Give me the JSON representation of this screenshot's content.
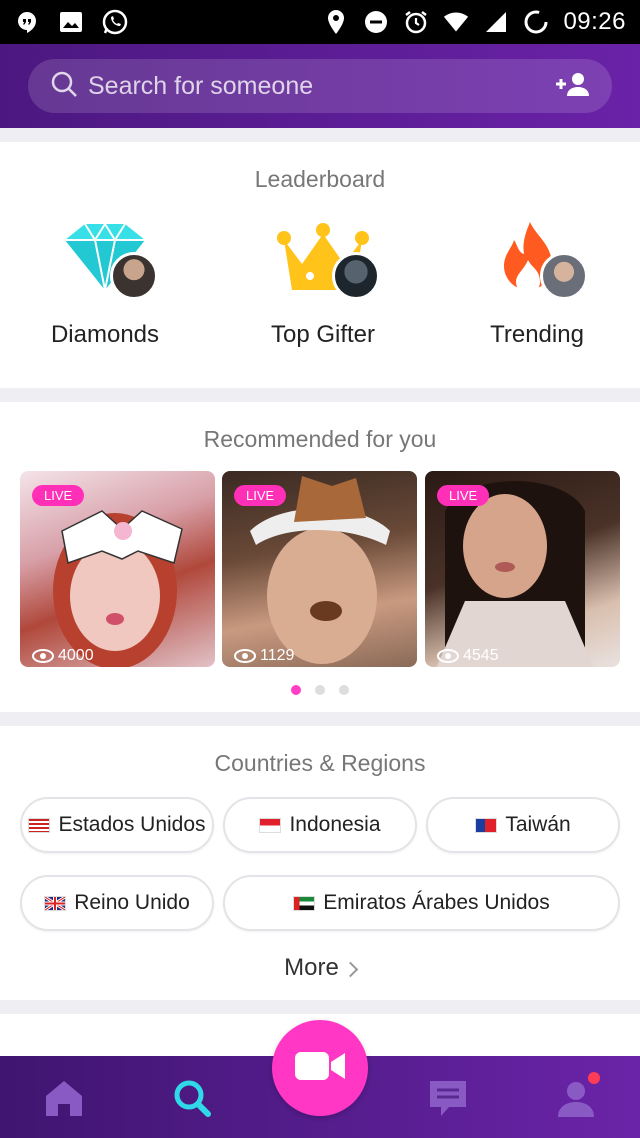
{
  "status_bar": {
    "time": "09:26",
    "icons": [
      "hangouts-icon",
      "gallery-icon",
      "whatsapp-icon",
      "location-icon",
      "dnd-icon",
      "alarm-icon",
      "wifi-icon",
      "signal-icon",
      "battery-icon"
    ]
  },
  "search": {
    "placeholder": "Search for someone",
    "icon": "search-icon",
    "add_user_icon": "add-user-icon"
  },
  "leaderboard": {
    "title": "Leaderboard",
    "items": [
      {
        "label": "Diamonds",
        "icon": "diamond-icon",
        "color": "#37dfe6"
      },
      {
        "label": "Top Gifter",
        "icon": "crown-icon",
        "color": "#ffc31a"
      },
      {
        "label": "Trending",
        "icon": "flame-icon",
        "color": "#ff5a1f"
      }
    ]
  },
  "recommended": {
    "title": "Recommended for you",
    "cards": [
      {
        "badge": "LIVE",
        "views": "4000"
      },
      {
        "badge": "LIVE",
        "views": "1129"
      },
      {
        "badge": "LIVE",
        "views": "4545"
      }
    ],
    "page_count": 3,
    "active_page": 1
  },
  "countries": {
    "title": "Countries & Regions",
    "chips": [
      {
        "label": "Estados Unidos",
        "flag": "us-flag-icon"
      },
      {
        "label": "Indonesia",
        "flag": "id-flag-icon"
      },
      {
        "label": "Taiwán",
        "flag": "tw-flag-icon"
      },
      {
        "label": "Reino Unido",
        "flag": "uk-flag-icon"
      },
      {
        "label": "Emiratos Árabes Unidos",
        "flag": "ae-flag-icon"
      }
    ],
    "more_label": "More"
  },
  "bottom_nav": {
    "items": [
      "home-icon",
      "search-icon",
      "video-camera-icon",
      "chat-icon",
      "profile-icon"
    ],
    "active": "search-icon",
    "accent": "#2fd9e8",
    "fab_color": "#ff37c4"
  }
}
